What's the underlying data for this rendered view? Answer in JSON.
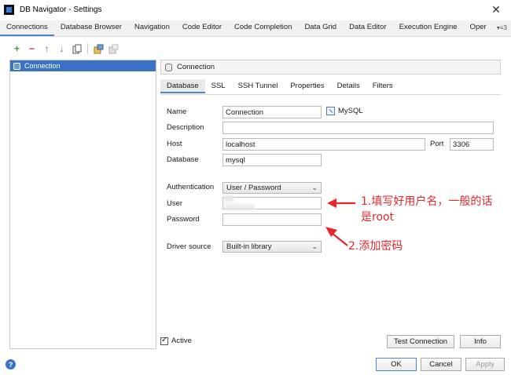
{
  "window": {
    "title": "DB Navigator - Settings",
    "close_glyph": "✕"
  },
  "tabs": [
    {
      "label": "Connections"
    },
    {
      "label": "Database Browser"
    },
    {
      "label": "Navigation"
    },
    {
      "label": "Code Editor"
    },
    {
      "label": "Code Completion"
    },
    {
      "label": "Data Grid"
    },
    {
      "label": "Data Editor"
    },
    {
      "label": "Execution Engine"
    },
    {
      "label": "Oper"
    }
  ],
  "tab_overflow": "▾≡3",
  "toolbar": {
    "add": "+",
    "remove": "−",
    "up": "↑",
    "down": "↓",
    "icons": [
      "add-icon",
      "remove-icon",
      "move-up-icon",
      "move-down-icon",
      "copy-icon",
      "export-icon",
      "import-icon"
    ]
  },
  "connections": [
    {
      "label": "Connection"
    }
  ],
  "header": {
    "title": "Connection"
  },
  "subtabs": [
    {
      "label": "Database"
    },
    {
      "label": "SSL"
    },
    {
      "label": "SSH Tunnel"
    },
    {
      "label": "Properties"
    },
    {
      "label": "Details"
    },
    {
      "label": "Filters"
    }
  ],
  "form": {
    "name_label": "Name",
    "name_value": "Connection",
    "db_type": "MySQL",
    "description_label": "Description",
    "description_value": "",
    "host_label": "Host",
    "host_value": "localhost",
    "port_label": "Port",
    "port_value": "3306",
    "database_label": "Database",
    "database_value": "mysql",
    "auth_label": "Authentication",
    "auth_value": "User / Password",
    "user_label": "User",
    "user_value": "",
    "password_label": "Password",
    "password_value": "",
    "driver_label": "Driver source",
    "driver_value": "Built-in library"
  },
  "annotations": {
    "note1_line1": "1.填写好用户名，一般的话",
    "note1_line2": "是root",
    "note2": "2.添加密码"
  },
  "footer": {
    "active_label": "Active",
    "test_button": "Test Connection",
    "info_button": "Info",
    "ok_button": "OK",
    "cancel_button": "Cancel",
    "apply_button": "Apply",
    "help": "?"
  },
  "colors": {
    "accent": "#4a88c7",
    "selection": "#3b73c4",
    "annotation": "#e8262b"
  }
}
